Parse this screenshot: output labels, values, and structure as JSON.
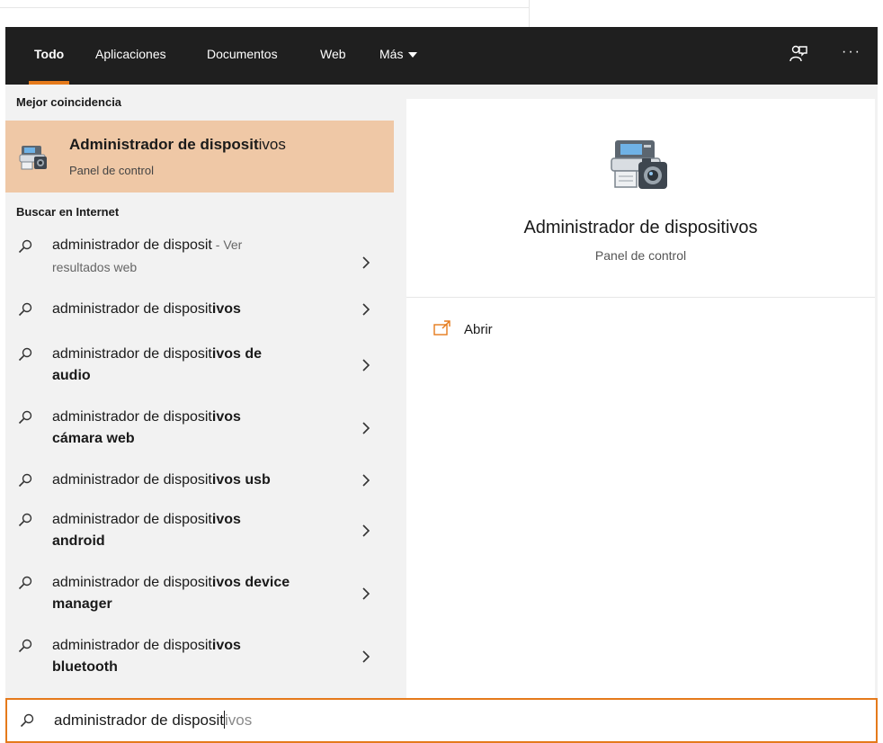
{
  "tabs": [
    {
      "label": "Todo",
      "active": true
    },
    {
      "label": "Aplicaciones"
    },
    {
      "label": "Documentos"
    },
    {
      "label": "Web"
    },
    {
      "label": "Más"
    }
  ],
  "accent_color": "#e57a1b",
  "best_match": {
    "header": "Mejor coincidencia",
    "title_bold": "Administrador de disposit",
    "title_rest": "ivos",
    "subtitle": "Panel de control",
    "icon": "device-manager-icon"
  },
  "web_section": {
    "header": "Buscar en Internet",
    "results": [
      {
        "normal": "administrador de disposit",
        "bold": "",
        "suffix": " - Ver",
        "suffix2": "resultados web"
      },
      {
        "normal": "administrador de disposit",
        "bold": "ivos"
      },
      {
        "normal": "administrador de disposit",
        "bold": "ivos de",
        "line2": "audio"
      },
      {
        "normal": "administrador de disposit",
        "bold": "ivos",
        "line2": "cámara web"
      },
      {
        "normal": "administrador de disposit",
        "bold": "ivos usb"
      },
      {
        "normal": "administrador de disposit",
        "bold": "ivos",
        "line2": "android"
      },
      {
        "normal": "administrador de disposit",
        "bold": "ivos device",
        "line2": "manager"
      },
      {
        "normal": "administrador de disposit",
        "bold": "ivos",
        "line2": "bluetooth"
      }
    ]
  },
  "preview": {
    "title": "Administrador de dispositivos",
    "subtitle": "Panel de control",
    "action_label": "Abrir"
  },
  "search": {
    "typed": "administrador de disposit",
    "ghost": "ivos"
  }
}
